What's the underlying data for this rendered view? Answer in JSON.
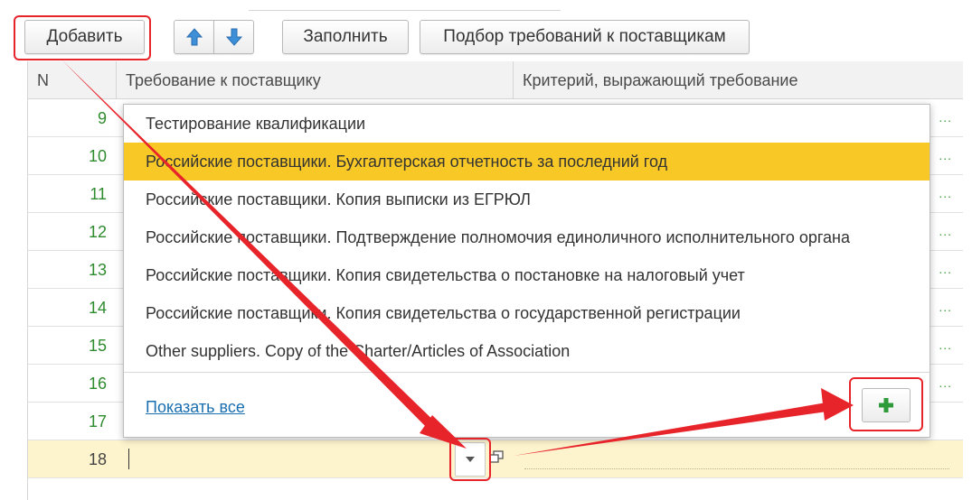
{
  "toolbar": {
    "add_label": "Добавить",
    "fill_label": "Заполнить",
    "select_label": "Подбор требований к поставщикам",
    "up_icon": "arrow-up-icon",
    "down_icon": "arrow-down-icon"
  },
  "table": {
    "columns": [
      "N",
      "Требование к поставщику",
      "Критерий, выражающий требование"
    ],
    "rows": [
      {
        "n": "9"
      },
      {
        "n": "10"
      },
      {
        "n": "11"
      },
      {
        "n": "12"
      },
      {
        "n": "13"
      },
      {
        "n": "14"
      },
      {
        "n": "15"
      },
      {
        "n": "16"
      },
      {
        "n": "17"
      },
      {
        "n": "18"
      }
    ],
    "row_dots": "..."
  },
  "dropdown": {
    "items": [
      "Тестирование квалификации",
      "Российские поставщики. Бухгалтерская отчетность за последний год",
      "Российские поставщики. Копия выписки из ЕГРЮЛ",
      "Российские поставщики. Подтверждение полномочия единоличного исполнительного органа",
      "Российские поставщики. Копия свидетельства о постановке на налоговый учет",
      "Российские поставщики. Копия свидетельства о государственной регистрации",
      "Other suppliers. Copy of the Charter/Articles of Association"
    ],
    "selected_index": 1,
    "show_all": "Показать все",
    "add_icon": "plus-icon"
  },
  "colors": {
    "highlight": "#e8242b",
    "selected": "#f8c926",
    "row_number": "#2e8b2e",
    "link": "#1a6fb0"
  }
}
